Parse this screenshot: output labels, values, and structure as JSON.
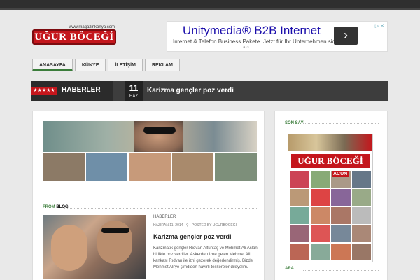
{
  "logo": {
    "site": "www.magazinkonya.com",
    "name": "UĞUR BÖCEĞİ"
  },
  "ad": {
    "title": "Unitymedia® B2B Internet",
    "subtitle": "Internet & Telefon Business Pakete. Jetzt für Ihr Unternehmen sichern!",
    "arrow": "›",
    "info": "▷ ✕"
  },
  "nav": {
    "items": [
      "ANASAYFA",
      "KÜNYE",
      "İLETİŞİM",
      "REKLAM"
    ]
  },
  "ticker": {
    "stars": "★★★★★",
    "label": "HABERLER",
    "day": "11",
    "month": "HAZ",
    "headline": "Karizma gençler poz verdi"
  },
  "blog": {
    "section_prefix": "FROM",
    "section_suffix": "BLOG",
    "category": "HABERLER",
    "date": "HAZİRAN 11, 2014",
    "author": "POSTED BY UGURBOCEGI",
    "title": "Karizma gençler poz verdi",
    "excerpt": "Karizmatik gençler Rıdvan Altuntaş ve Mehmet Ali Aslan birlikte poz verdiler. Askerden izne gelen Mehmet Ali, kankası Rıdvan ile izni gezerek değerlendirmiş. Bizde Mehmet Ali'ye şimdiden hayırlı teskereler dileyelim."
  },
  "sidebar": {
    "issue_title": "SON SAYI",
    "cover_logo": "UĞUR BÖCEĞİ",
    "cover_badge": "ACUN",
    "search_title": "ARA"
  }
}
